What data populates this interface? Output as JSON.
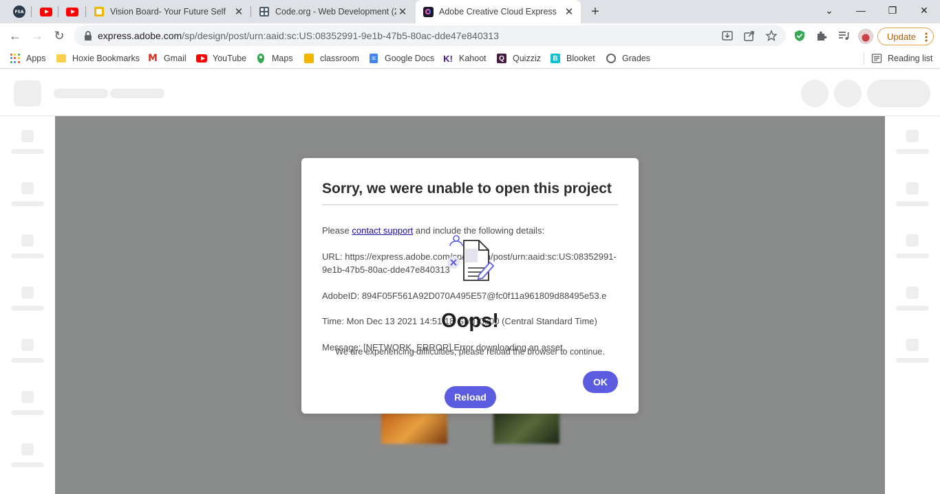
{
  "tabs": {
    "pinned": [
      {
        "label": "FSA",
        "icon": "fsa-icon"
      },
      {
        "icon": "youtube-icon"
      },
      {
        "icon": "youtube-icon"
      }
    ],
    "items": [
      {
        "title": "Vision Board- Your Future Self",
        "icon": "google-slides-icon"
      },
      {
        "title": "Code.org - Web Development (2",
        "icon": "code-org-icon"
      },
      {
        "title": "Adobe Creative Cloud Express",
        "icon": "creative-cloud-express-icon",
        "active": true
      }
    ],
    "close_glyph": "✕",
    "new_tab_glyph": "+"
  },
  "window": {
    "dropdown": "⌄",
    "minimize": "—",
    "restore": "❐",
    "close": "✕"
  },
  "toolbar": {
    "back": "←",
    "forward": "→",
    "reload": "↻",
    "url_host": "express.adobe.com",
    "url_path": "/sp/design/post/urn:aaid:sc:US:08352991-9e1b-47b5-80ac-dde47e840313",
    "update_label": "Update"
  },
  "bookmarks": [
    {
      "label": "Apps",
      "icon": "apps-grid-icon"
    },
    {
      "label": "Hoxie Bookmarks",
      "icon": "folder-icon"
    },
    {
      "label": "Gmail",
      "icon": "gmail-icon"
    },
    {
      "label": "YouTube",
      "icon": "youtube-icon"
    },
    {
      "label": "Maps",
      "icon": "maps-icon"
    },
    {
      "label": "classroom",
      "icon": "classroom-icon"
    },
    {
      "label": "Google Docs",
      "icon": "google-docs-icon"
    },
    {
      "label": "Kahoot",
      "icon": "kahoot-icon"
    },
    {
      "label": "Quizziz",
      "icon": "quizizz-icon"
    },
    {
      "label": "Blooket",
      "icon": "blooket-icon"
    },
    {
      "label": "Grades",
      "icon": "globe-icon"
    }
  ],
  "reading_list": "Reading list",
  "dialog": {
    "title": "Sorry, we were unable to open this project",
    "please_prefix": "Please ",
    "contact_link": "contact support",
    "please_suffix": " and include the following details:",
    "url_line_1": "URL: https://express.adobe.com/sp/design/post/urn:aaid:sc:US:08352991-",
    "url_line_2": "9e1b-47b5-80ac-dde47e840313",
    "adobe_id": "AdobeID: 894F05F561A92D070A495E57@fc0f11a961809d88495e53.e",
    "time": "Time: Mon Dec 13 2021 14:51:18 GMT-0600 (Central Standard Time)",
    "message": "Message: [NETWORK_ERROR] Error downloading an asset.",
    "ok_label": "OK"
  },
  "oops": {
    "title": "Oops!",
    "message": "We are experiencing difficulties, please reload the browser to continue.",
    "reload_label": "Reload"
  },
  "colors": {
    "accent": "#5c5ce0",
    "canvas": "#8a8b8b",
    "skeleton": "#eeeeee"
  }
}
